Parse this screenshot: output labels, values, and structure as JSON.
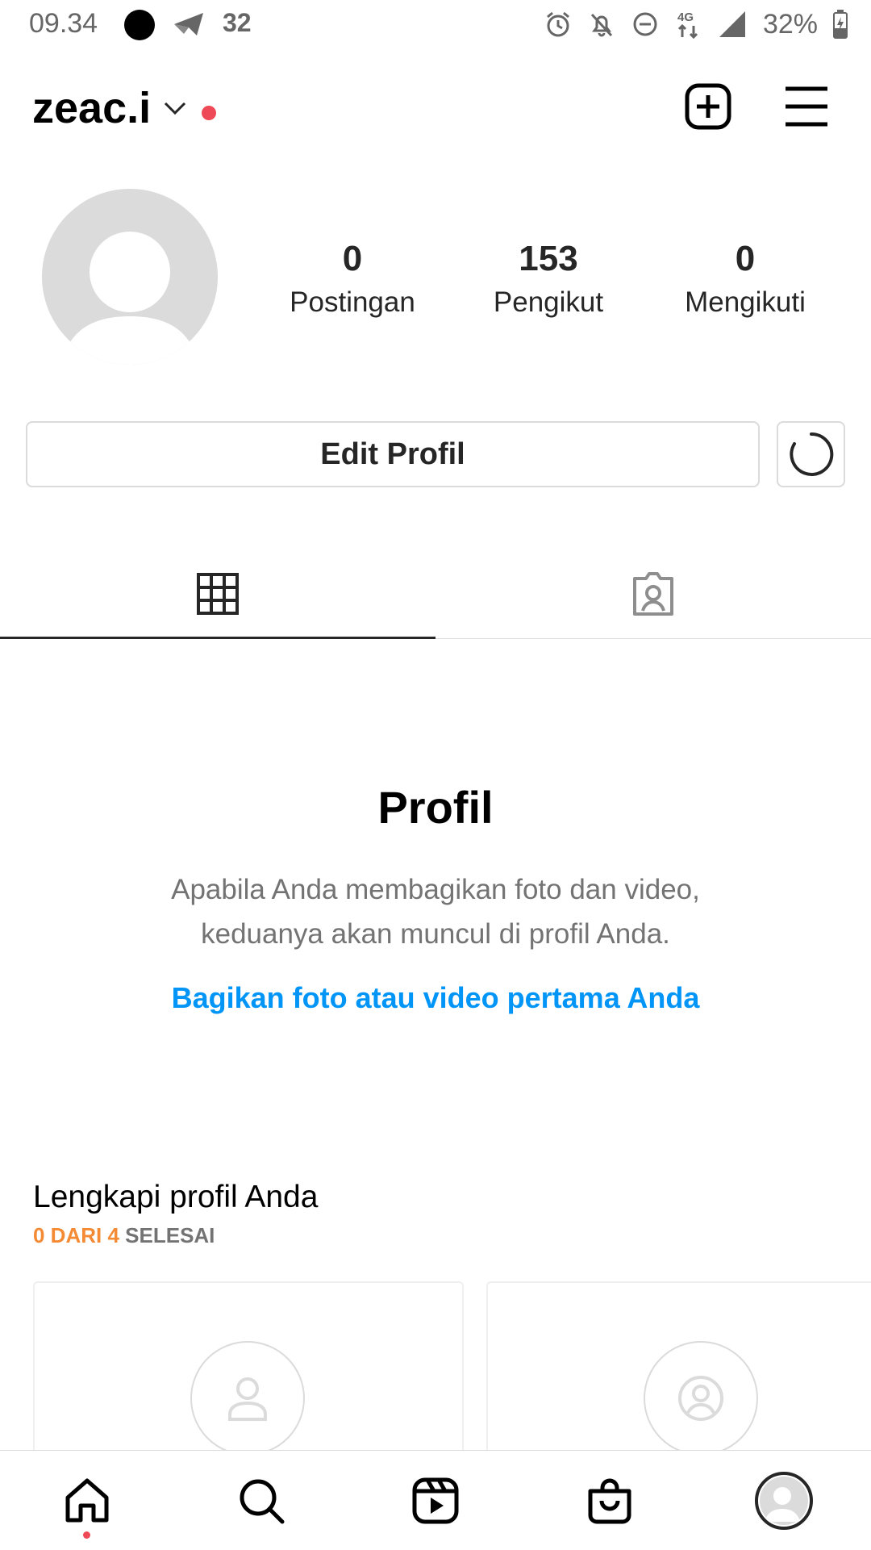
{
  "status_bar": {
    "time": "09.34",
    "notification_count": "32",
    "battery_percent": "32%",
    "network": "4G"
  },
  "header": {
    "username": "zeac.i",
    "has_notification_dot": true
  },
  "profile": {
    "stats": [
      {
        "value": "0",
        "label": "Postingan"
      },
      {
        "value": "153",
        "label": "Pengikut"
      },
      {
        "value": "0",
        "label": "Mengikuti"
      }
    ],
    "edit_button": "Edit Profil"
  },
  "tabs": [
    {
      "name": "grid",
      "active": true
    },
    {
      "name": "tagged",
      "active": false
    }
  ],
  "empty_state": {
    "title": "Profil",
    "description_line1": "Apabila Anda membagikan foto dan video,",
    "description_line2": "keduanya akan muncul di profil Anda.",
    "link": "Bagikan foto atau video pertama Anda"
  },
  "complete_profile": {
    "title": "Lengkapi profil Anda",
    "progress_done": "0 DARI 4",
    "progress_suffix": "SELESAI"
  },
  "colors": {
    "accent_link": "#0095f6",
    "progress_orange": "#f58a35",
    "notification_red": "#ed4956"
  },
  "bottom_nav": {
    "items": [
      "home-icon",
      "search-icon",
      "reels-icon",
      "shop-icon",
      "profile-avatar"
    ],
    "active": "profile-avatar"
  }
}
